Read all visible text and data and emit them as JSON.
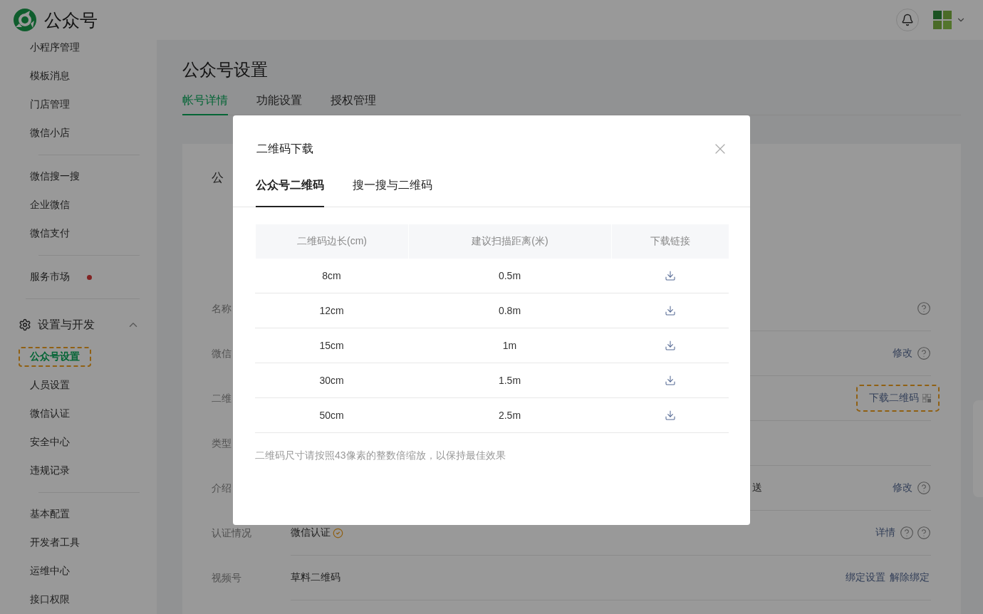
{
  "header": {
    "brand": "公众号"
  },
  "sidebar": {
    "groups": [
      {
        "items": [
          {
            "label": "小程序管理",
            "selected": false,
            "dot": false
          },
          {
            "label": "模板消息",
            "selected": false,
            "dot": false
          },
          {
            "label": "门店管理",
            "selected": false,
            "dot": false
          },
          {
            "label": "微信小店",
            "selected": false,
            "dot": false
          }
        ]
      },
      {
        "items": [
          {
            "label": "微信搜一搜",
            "selected": false,
            "dot": false
          },
          {
            "label": "企业微信",
            "selected": false,
            "dot": false
          },
          {
            "label": "微信支付",
            "selected": false,
            "dot": false
          }
        ]
      },
      {
        "items": [
          {
            "label": "服务市场",
            "selected": false,
            "dot": true
          }
        ]
      }
    ],
    "section": {
      "title": "设置与开发",
      "expanded": true,
      "groups": [
        {
          "items": [
            {
              "label": "公众号设置",
              "selected": true,
              "highlighted": true
            },
            {
              "label": "人员设置",
              "selected": false,
              "highlighted": false
            },
            {
              "label": "微信认证",
              "selected": false,
              "highlighted": false
            },
            {
              "label": "安全中心",
              "selected": false,
              "highlighted": false
            },
            {
              "label": "违规记录",
              "selected": false,
              "highlighted": false
            }
          ]
        },
        {
          "items": [
            {
              "label": "基本配置",
              "selected": false,
              "highlighted": false
            },
            {
              "label": "开发者工具",
              "selected": false,
              "highlighted": false
            },
            {
              "label": "运维中心",
              "selected": false,
              "highlighted": false
            },
            {
              "label": "接口权限",
              "selected": false,
              "highlighted": false
            }
          ]
        }
      ]
    }
  },
  "main": {
    "title": "公众号设置",
    "tabs": [
      {
        "label": "帐号详情",
        "selected": true
      },
      {
        "label": "功能设置",
        "selected": false
      },
      {
        "label": "授权管理",
        "selected": false
      }
    ],
    "card": {
      "section_title": "公",
      "rows": [
        {
          "label": "名称",
          "actions": [
            {
              "kind": "help"
            }
          ]
        },
        {
          "label": "微信",
          "actions": [
            {
              "kind": "link",
              "text": "修改"
            },
            {
              "kind": "help"
            }
          ]
        },
        {
          "label": "二维",
          "actions": [
            {
              "kind": "download",
              "text": "下载二维码",
              "highlighted": true
            }
          ]
        },
        {
          "label": "类型",
          "actions": []
        },
        {
          "label": "介绍",
          "value_tail": "送",
          "actions": [
            {
              "kind": "link",
              "text": "修改"
            },
            {
              "kind": "help"
            }
          ]
        },
        {
          "label": "认证情况",
          "value": "微信认证",
          "verified": true,
          "actions": [
            {
              "kind": "link",
              "text": "详情"
            },
            {
              "kind": "help"
            },
            {
              "kind": "help"
            }
          ]
        },
        {
          "label": "视频号",
          "value": "草料二维码",
          "actions": [
            {
              "kind": "link",
              "text": "绑定设置"
            },
            {
              "kind": "link",
              "text": "解除绑定"
            }
          ]
        }
      ]
    }
  },
  "modal": {
    "title": "二维码下载",
    "tabs": [
      {
        "label": "公众号二维码",
        "selected": true
      },
      {
        "label": "搜一搜与二维码",
        "selected": false
      }
    ],
    "table": {
      "columns": [
        "二维码边长(cm)",
        "建议扫描距离(米)",
        "下载链接"
      ],
      "rows": [
        {
          "size": "8cm",
          "distance": "0.5m"
        },
        {
          "size": "12cm",
          "distance": "0.8m"
        },
        {
          "size": "15cm",
          "distance": "1m"
        },
        {
          "size": "30cm",
          "distance": "1.5m"
        },
        {
          "size": "50cm",
          "distance": "2.5m"
        }
      ]
    },
    "note": "二维码尺寸请按照43像素的整数倍缩放，以保持最佳效果"
  }
}
